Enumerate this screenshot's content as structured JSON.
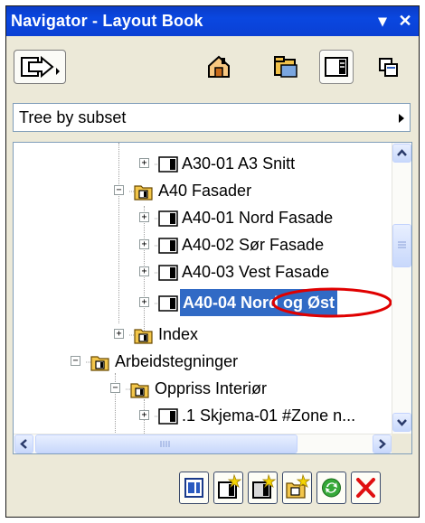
{
  "window": {
    "title": "Navigator - Layout Book",
    "menu_glyph": "▾",
    "close_glyph": "✕"
  },
  "toolbar": {
    "icons": [
      "navigator-switch-icon",
      "project-map-icon",
      "view-map-icon",
      "layout-book-icon",
      "publisher-sets-icon"
    ]
  },
  "view_selector": {
    "value": "Tree by subset"
  },
  "tree": {
    "rows": [
      {
        "label": "A30-01 A3 Snitt",
        "icon": "layout-sheet-icon",
        "expander": "+"
      },
      {
        "label": "A40 Fasader",
        "icon": "subset-folder-icon",
        "expander": "−"
      },
      {
        "label": "A40-01 Nord Fasade",
        "icon": "layout-sheet-icon",
        "expander": "+"
      },
      {
        "label": "A40-02 Sør Fasade",
        "icon": "layout-sheet-icon",
        "expander": "+"
      },
      {
        "label": "A40-03 Vest Fasade",
        "icon": "layout-sheet-icon",
        "expander": "+"
      },
      {
        "label": "A40-04 Nord og Øst",
        "icon": "layout-sheet-icon",
        "expander": "+",
        "selected": true
      },
      {
        "label": "Index",
        "icon": "subset-folder-icon",
        "expander": "+"
      },
      {
        "label": "Arbeidstegninger",
        "icon": "subset-folder-icon",
        "expander": "−"
      },
      {
        "label": "Oppriss Interiør",
        "icon": "subset-folder-icon",
        "expander": "−"
      },
      {
        "label": ".1 Skjema-01 #Zone n...",
        "icon": "layout-sheet-icon",
        "expander": "+"
      }
    ],
    "annotation_color": "#e00000",
    "selection_color": "#316ac5"
  },
  "bottom": {
    "buttons": [
      "properties-icon",
      "new-layout-icon",
      "new-master-layout-icon",
      "new-subset-icon",
      "update-icon",
      "delete-icon"
    ]
  }
}
